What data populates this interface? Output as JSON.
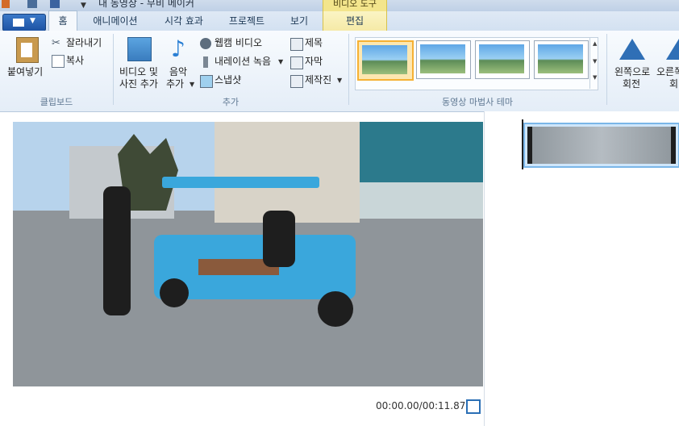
{
  "window": {
    "title": "내 동영상 - 무비 메이커"
  },
  "context_tab": {
    "header": "비디오 도구",
    "label": "편집"
  },
  "tabs": [
    {
      "label": "홈",
      "active": true
    },
    {
      "label": "애니메이션"
    },
    {
      "label": "시각 효과"
    },
    {
      "label": "프로젝트"
    },
    {
      "label": "보기"
    }
  ],
  "clipboard": {
    "paste_label": "붙여넣기",
    "cut_label": "잘라내기",
    "copy_label": "복사",
    "group_label": "클립보드"
  },
  "add": {
    "video_photo_line1": "비디오 및",
    "video_photo_line2": "사진 추가",
    "music_line1": "음악",
    "music_line2": "추가",
    "webcam_label": "웹캠 비디오",
    "narration_label": "내레이션 녹음",
    "snapshot_label": "스냅샷",
    "title_label": "제목",
    "caption_label": "자막",
    "credits_label": "제작진",
    "group_label": "추가"
  },
  "themes": {
    "group_label": "동영상 마법사 테마",
    "count": 4
  },
  "rotate": {
    "left_line1": "왼쪽으로",
    "left_line2": "회전",
    "right_line1": "오른쪽",
    "right_line2": "회"
  },
  "preview": {
    "time": "00:00.00/00:11.87"
  },
  "colors": {
    "accent": "#2b6fb5",
    "selected_theme": "#f6b133",
    "cart": "#2ea6df"
  }
}
